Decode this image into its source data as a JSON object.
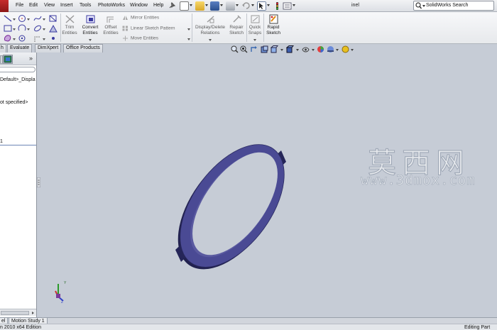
{
  "menu_bar": {
    "items": [
      "File",
      "Edit",
      "View",
      "Insert",
      "Tools",
      "PhotoWorks",
      "Window",
      "Help"
    ],
    "document_title": "inel",
    "search_placeholder": "SolidWorks Search"
  },
  "command_manager": {
    "trim_entities": "Trim Entities",
    "convert_entities": "Convert Entities",
    "offset_entities": "Offset Entities",
    "mirror_entities": "Mirror Entities",
    "linear_sketch_pattern": "Linear Sketch Pattern",
    "move_entities": "Move Entities",
    "display_delete_relations": "Display/Delete Relations",
    "repair_sketch": "Repair Sketch",
    "quick_snaps": "Quick Snaps",
    "rapid_sketch": "Rapid Sketch",
    "tabs": [
      "h",
      "Evaluate",
      "DimXpert",
      "Office Products"
    ]
  },
  "feature_tree": {
    "lines": [
      "Default>_Displa",
      "ot specified>",
      "1"
    ]
  },
  "watermark": {
    "chinese": "莫西网",
    "url": "www.3dmox.com"
  },
  "bottom_tabs": [
    "el",
    "Motion Study 1"
  ],
  "status_bar": {
    "left": "n 2010 x64 Edition",
    "right": "Editing Part"
  },
  "colors": {
    "viewport_background": "#c6ccd6",
    "part_face": "#4a4a94",
    "part_edge": "#21214f",
    "accent_red": "#c62d2d"
  }
}
